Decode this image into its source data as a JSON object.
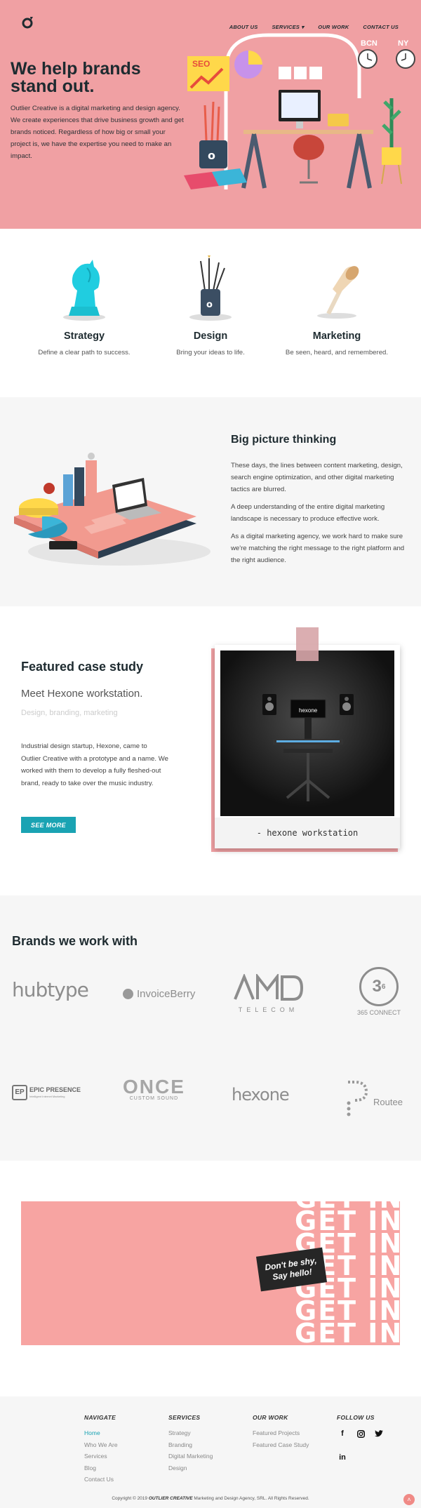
{
  "header": {
    "nav": [
      "ABOUT US",
      "SERVICES",
      "OUR WORK",
      "CONTACT US"
    ],
    "services_has_dropdown": true
  },
  "hero": {
    "title": "We help brands stand out.",
    "text": "Outlier Creative is a digital marketing and design agency. We create experiences that drive business growth and get brands noticed. Regardless of how big or small your project is, we have the expertise you need to make an impact.",
    "sign_text": "SEO",
    "clock_labels": [
      "BCN",
      "NY"
    ],
    "bg_color": "#f0a0a3"
  },
  "services": [
    {
      "title": "Strategy",
      "desc": "Define a clear path to success.",
      "icon": "chess-knight-icon"
    },
    {
      "title": "Design",
      "desc": "Bring your ideas to life.",
      "icon": "pencil-cup-icon"
    },
    {
      "title": "Marketing",
      "desc": "Be seen, heard, and remembered.",
      "icon": "megaphone-icon"
    }
  ],
  "big_picture": {
    "title": "Big picture thinking",
    "paragraphs": [
      "These days, the lines between content marketing, design, search engine optimization, and other digital marketing tactics are blurred.",
      "A deep understanding of the entire digital marketing landscape is necessary to produce effective work.",
      "As a digital marketing agency, we work hard to make sure we're matching the right message to the right platform and the right audience."
    ]
  },
  "case_study": {
    "title": "Featured case study",
    "subtitle": "Meet Hexone workstation.",
    "tags": "Design, branding, marketing",
    "description": "Industrial design startup, Hexone, came to Outlier Creative with a prototype and a name. We worked with them to develop a fully fleshed-out brand, ready to take over the music industry.",
    "button": "SEE MORE",
    "caption": "- hexone workstation",
    "photo_brand": "hexone",
    "accent": "#1aa3b3"
  },
  "brands": {
    "title": "Brands we work with",
    "logos": [
      "hubtype",
      "InvoiceBerry",
      "AMD TELECOM",
      "365 CONNECT",
      "EPIC PRESENCE",
      "ONCE CUSTOM SOUND",
      "hexone",
      "Routee"
    ],
    "logo_subtexts": {
      "amd": "TELECOM",
      "connect": "365 CONNECT",
      "epic": "Intelligent Internet Marketing",
      "once": "CUSTOM SOUND"
    }
  },
  "cta": {
    "repeat_text": "GET IN",
    "badge": "Don't be shy, Say hello!",
    "bg_color": "#f7a4a2"
  },
  "footer": {
    "columns": [
      {
        "heading": "NAVIGATE",
        "links": [
          "Home",
          "Who We Are",
          "Services",
          "Blog",
          "Contact Us"
        ]
      },
      {
        "heading": "SERVICES",
        "links": [
          "Strategy",
          "Branding",
          "Digital Marketing",
          "Design"
        ]
      },
      {
        "heading": "OUR WORK",
        "links": [
          "Featured Projects",
          "Featured Case Study"
        ]
      },
      {
        "heading": "FOLLOW US",
        "links": []
      }
    ],
    "social": [
      "facebook-icon",
      "instagram-icon",
      "twitter-icon",
      "linkedin-icon"
    ],
    "copyright_pre": "Copyright © 2019",
    "copyright_brand": "OUTLIER CREATIVE",
    "copyright_post": "Marketing and Design Agency, SRL. All Rights Reserved."
  }
}
